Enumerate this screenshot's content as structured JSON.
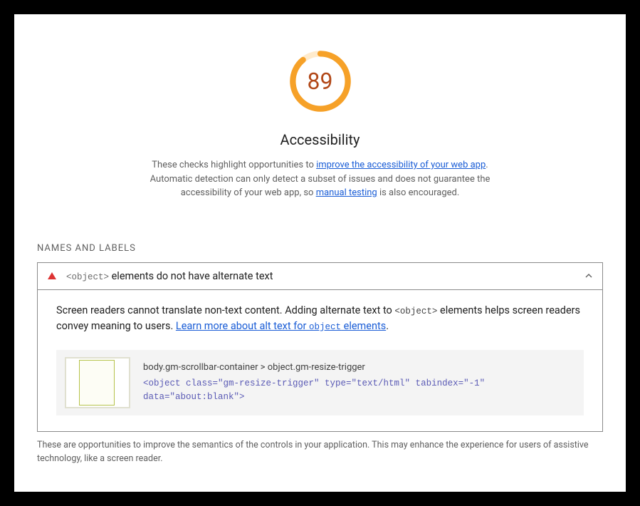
{
  "score": {
    "value": 89,
    "percent": 0.89,
    "title": "Accessibility",
    "desc_pre": "These checks highlight opportunities to ",
    "link1": "improve the accessibility of your web app",
    "desc_mid": ". Automatic detection can only detect a subset of issues and does not guarantee the accessibility of your web app, so ",
    "link2": "manual testing",
    "desc_post": " is also encouraged."
  },
  "section": {
    "header": "NAMES AND LABELS"
  },
  "audit": {
    "code_tag": "<object>",
    "title_rest": " elements do not have alternate text",
    "desc_pre": "Screen readers cannot translate non-text content. Adding alternate text to ",
    "desc_code": "<object>",
    "desc_mid": " elements helps screen readers convey meaning to users. ",
    "learn_pre": "Learn more about alt text for ",
    "learn_code": "object",
    "learn_post": " elements",
    "selector": "body.gm-scrollbar-container > object.gm-resize-trigger",
    "snippet": "<object class=\"gm-resize-trigger\" type=\"text/html\" tabindex=\"-1\" data=\"about:blank\">"
  },
  "footer": "These are opportunities to improve the semantics of the controls in your application. This may enhance the experience for users of assistive technology, like a screen reader."
}
